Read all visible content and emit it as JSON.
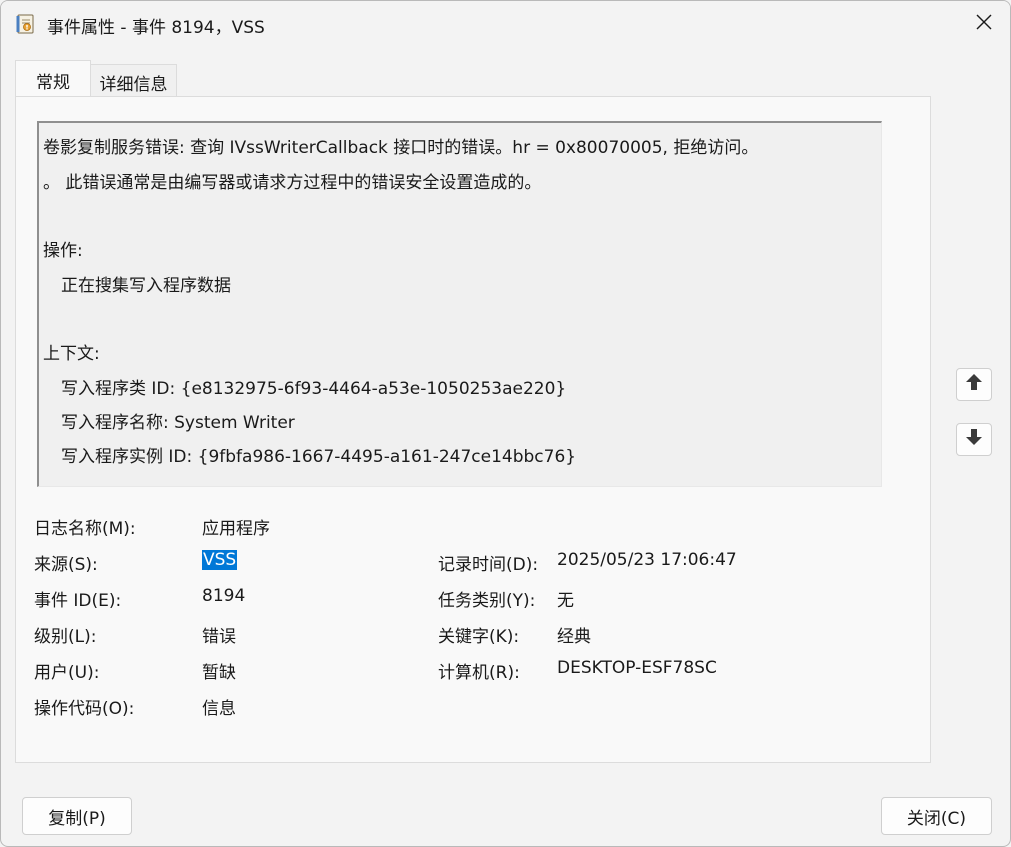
{
  "window": {
    "title": "事件属性 - 事件 8194，VSS"
  },
  "tabs": [
    {
      "label": "常规",
      "active": true
    },
    {
      "label": "详细信息",
      "active": false
    }
  ],
  "description": {
    "lines": [
      "卷影复制服务错误: 查询 IVssWriterCallback 接口时的错误。hr = 0x80070005, 拒绝访问。",
      "。 此错误通常是由编写器或请求方过程中的错误安全设置造成的。",
      "操作:",
      "正在搜集写入程序数据",
      "上下文:",
      "写入程序类 ID: {e8132975-6f93-4464-a53e-1050253ae220}",
      "写入程序名称: System Writer",
      "写入程序实例 ID: {9fbfa986-1667-4495-a161-247ce14bbc76}"
    ]
  },
  "fields": {
    "log_name_label": "日志名称(M):",
    "log_name_value": "应用程序",
    "source_label": "来源(S):",
    "source_value": "VSS",
    "logged_label": "记录时间(D):",
    "logged_value": "2025/05/23 17:06:47",
    "event_id_label": "事件 ID(E):",
    "event_id_value": "8194",
    "task_category_label": "任务类别(Y):",
    "task_category_value": "无",
    "level_label": "级别(L):",
    "level_value": "错误",
    "keywords_label": "关键字(K):",
    "keywords_value": "经典",
    "user_label": "用户(U):",
    "user_value": "暂缺",
    "computer_label": "计算机(R):",
    "computer_value": "DESKTOP-ESF78SC",
    "opcode_label": "操作代码(O):",
    "opcode_value": "信息"
  },
  "buttons": {
    "copy_label": "复制(P)",
    "close_label": "关闭(C)"
  },
  "icons": {
    "window": "event-properties-icon",
    "close": "close-icon",
    "up": "arrow-up-icon",
    "down": "arrow-down-icon"
  },
  "colors": {
    "selection": "#0078d7",
    "window_bg": "#f3f3f3"
  }
}
